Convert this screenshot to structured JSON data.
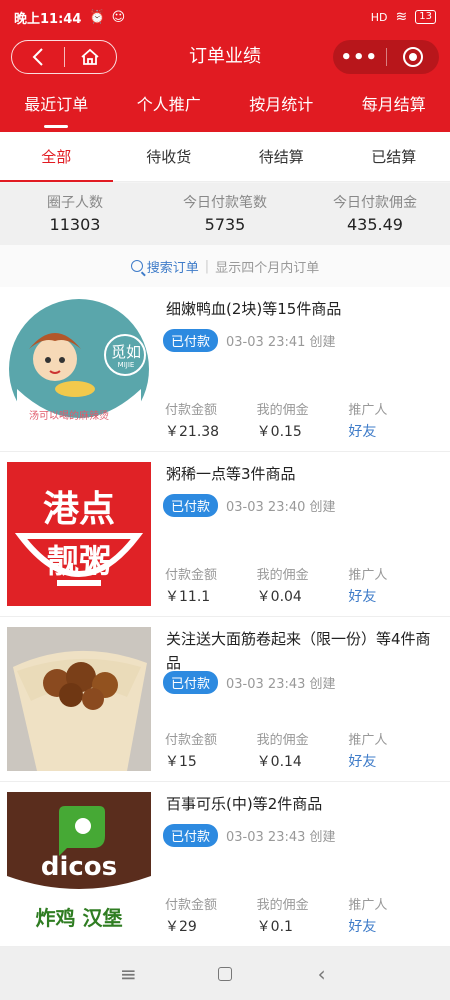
{
  "status_bar": {
    "time": "晚上11:44",
    "signal": "HD",
    "battery": "13"
  },
  "nav": {
    "title": "订单业绩",
    "back_icon": "chevron-left",
    "home_icon": "home",
    "more_icon": "more-dots",
    "close_icon": "target-circle"
  },
  "top_tabs": [
    {
      "label": "最近订单",
      "active": true
    },
    {
      "label": "个人推广",
      "active": false
    },
    {
      "label": "按月统计",
      "active": false
    },
    {
      "label": "每月结算",
      "active": false
    }
  ],
  "status_tabs": [
    {
      "label": "全部",
      "active": true
    },
    {
      "label": "待收货",
      "active": false
    },
    {
      "label": "待结算",
      "active": false
    },
    {
      "label": "已结算",
      "active": false
    }
  ],
  "stats": [
    {
      "label": "圈子人数",
      "value": "11303"
    },
    {
      "label": "今日付款笔数",
      "value": "5735"
    },
    {
      "label": "今日付款佣金",
      "value": "435.49"
    }
  ],
  "search": {
    "link": "搜索订单",
    "hint": "显示四个月内订单"
  },
  "orders": [
    {
      "title": "细嫩鸭血(2块)等15件商品",
      "badge": "已付款",
      "time": "03-03 23:41 创建",
      "pay_label": "付款金额",
      "pay": "￥21.38",
      "comm_label": "我的佣金",
      "comm": "￥0.15",
      "promo_label": "推广人",
      "promo": "好友",
      "thumb_text": "觅如",
      "thumb_sub": "MIJIE",
      "thumb_slogan": "汤可以喝的麻辣烫"
    },
    {
      "title": "粥稀一点等3件商品",
      "badge": "已付款",
      "time": "03-03 23:40 创建",
      "pay_label": "付款金额",
      "pay": "￥11.1",
      "comm_label": "我的佣金",
      "comm": "￥0.04",
      "promo_label": "推广人",
      "promo": "好友",
      "thumb_text": "港点",
      "thumb_sub": "靓粥"
    },
    {
      "title": "关注送大面筋卷起来（限一份）等4件商品",
      "badge": "已付款",
      "time": "03-03 23:43 创建",
      "pay_label": "付款金额",
      "pay": "￥15",
      "comm_label": "我的佣金",
      "comm": "￥0.14",
      "promo_label": "推广人",
      "promo": "好友"
    },
    {
      "title": "百事可乐(中)等2件商品",
      "badge": "已付款",
      "time": "03-03 23:43 创建",
      "pay_label": "付款金额",
      "pay": "￥29",
      "comm_label": "我的佣金",
      "comm": "￥0.1",
      "promo_label": "推广人",
      "promo": "好友",
      "thumb_text": "dicos",
      "thumb_sub": "炸鸡 汉堡"
    }
  ]
}
